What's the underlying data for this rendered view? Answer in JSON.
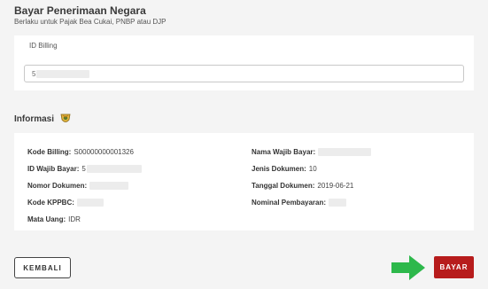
{
  "header": {
    "title": "Bayar Penerimaan Negara",
    "subtitle": "Berlaku untuk Pajak Bea Cukai, PNBP atau DJP"
  },
  "billing": {
    "label": "ID Billing",
    "input_value": "5"
  },
  "informasi": {
    "title": "Informasi",
    "icon": "badge-icon",
    "left": [
      {
        "label": "Kode Billing:",
        "value": "S00000000001326"
      },
      {
        "label": "ID Wajib Bayar:",
        "value": "5"
      },
      {
        "label": "Nomor Dokumen:",
        "value": ""
      },
      {
        "label": "Kode KPPBC:",
        "value": ""
      },
      {
        "label": "Mata Uang:",
        "value": "IDR"
      }
    ],
    "right": [
      {
        "label": "Nama Wajib Bayar:",
        "value": ""
      },
      {
        "label": "Jenis Dokumen:",
        "value": "10"
      },
      {
        "label": "Tanggal Dokumen:",
        "value": "2019-06-21"
      },
      {
        "label": "Nominal Pembayaran:",
        "value": ""
      }
    ]
  },
  "actions": {
    "back_label": "KEMBALI",
    "pay_label": "BAYAR"
  },
  "colors": {
    "pay_button": "#b71c1c",
    "arrow": "#2db84b"
  }
}
